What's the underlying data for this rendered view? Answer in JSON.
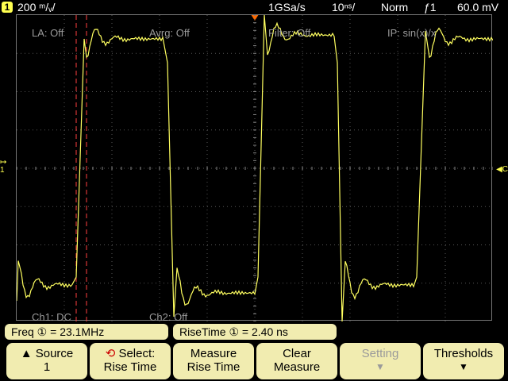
{
  "top": {
    "channel": "1",
    "vscale": "200 ᵐ/ᵥ/",
    "sample_rate": "1GSa/s",
    "time_scale": "10ⁿˢ/",
    "mode": "Norm",
    "trigger": "ƒ1",
    "level": "60.0 mV"
  },
  "status": {
    "la": "LA: Off",
    "avrg": "Avrg: Off",
    "filter": "Filter: Off",
    "ip": "IP: sin(x)/x",
    "ch1": "Ch1: DC",
    "ch2": "Ch2: Off"
  },
  "measurements": {
    "freq_label": "Freq ① =",
    "freq_value": "23.1MHz",
    "rise_label": "RiseTime ① =",
    "rise_value": "2.40 ns"
  },
  "softkeys": [
    {
      "line1": "▲ Source",
      "line2": "1"
    },
    {
      "line1": "Select:",
      "line2": "Rise Time"
    },
    {
      "line1": "Measure",
      "line2": "Rise Time"
    },
    {
      "line1": "Clear",
      "line2": "Measure"
    },
    {
      "line1": "Setting",
      "line2": ""
    },
    {
      "line1": "Thresholds",
      "line2": ""
    }
  ],
  "colors": {
    "trace": "#ffff60",
    "cursor": "#ff4040",
    "softkey": "#f1ecb0"
  }
}
